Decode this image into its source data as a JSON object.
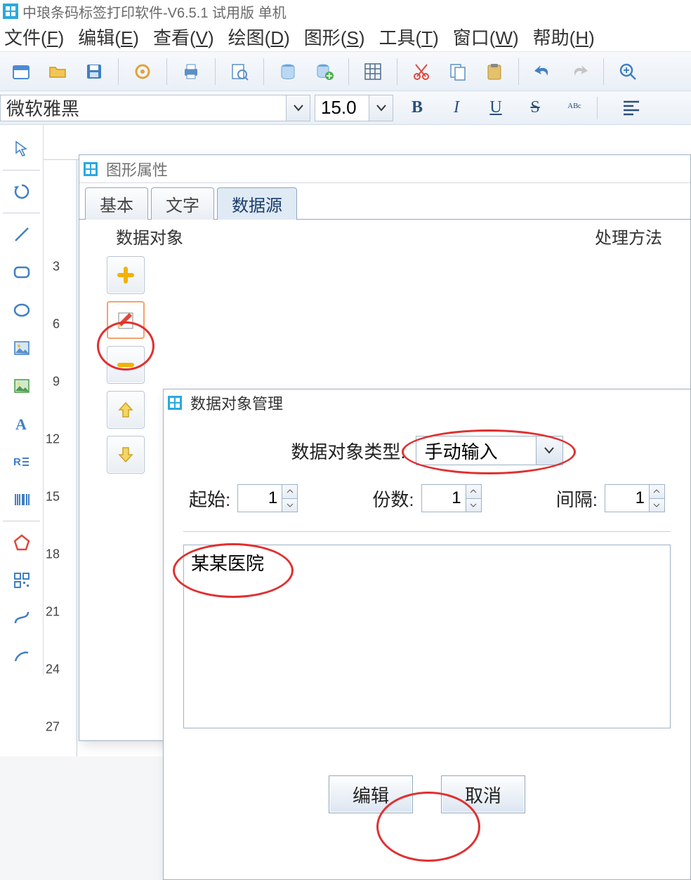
{
  "app": {
    "title": "中琅条码标签打印软件-V6.5.1 试用版 单机"
  },
  "menu": {
    "file": {
      "label": "文件",
      "accel": "F"
    },
    "edit": {
      "label": "编辑",
      "accel": "E"
    },
    "view": {
      "label": "查看",
      "accel": "V"
    },
    "draw": {
      "label": "绘图",
      "accel": "D"
    },
    "shape": {
      "label": "图形",
      "accel": "S"
    },
    "tool": {
      "label": "工具",
      "accel": "T"
    },
    "window": {
      "label": "窗口",
      "accel": "W"
    },
    "help": {
      "label": "帮助",
      "accel": "H"
    }
  },
  "font": {
    "name": "微软雅黑",
    "size": "15.0"
  },
  "propwin": {
    "title": "图形属性",
    "tabs": {
      "basic": "基本",
      "text": "文字",
      "source": "数据源"
    },
    "group_left": "数据对象",
    "group_right": "处理方法"
  },
  "mgr": {
    "title": "数据对象管理",
    "type_label": "数据对象类型:",
    "type_value": "手动输入",
    "start_label": "起始:",
    "start_value": "1",
    "copies_label": "份数:",
    "copies_value": "1",
    "interval_label": "间隔:",
    "interval_value": "1",
    "text": "某某医院",
    "edit_btn": "编辑",
    "cancel_btn": "取消"
  }
}
